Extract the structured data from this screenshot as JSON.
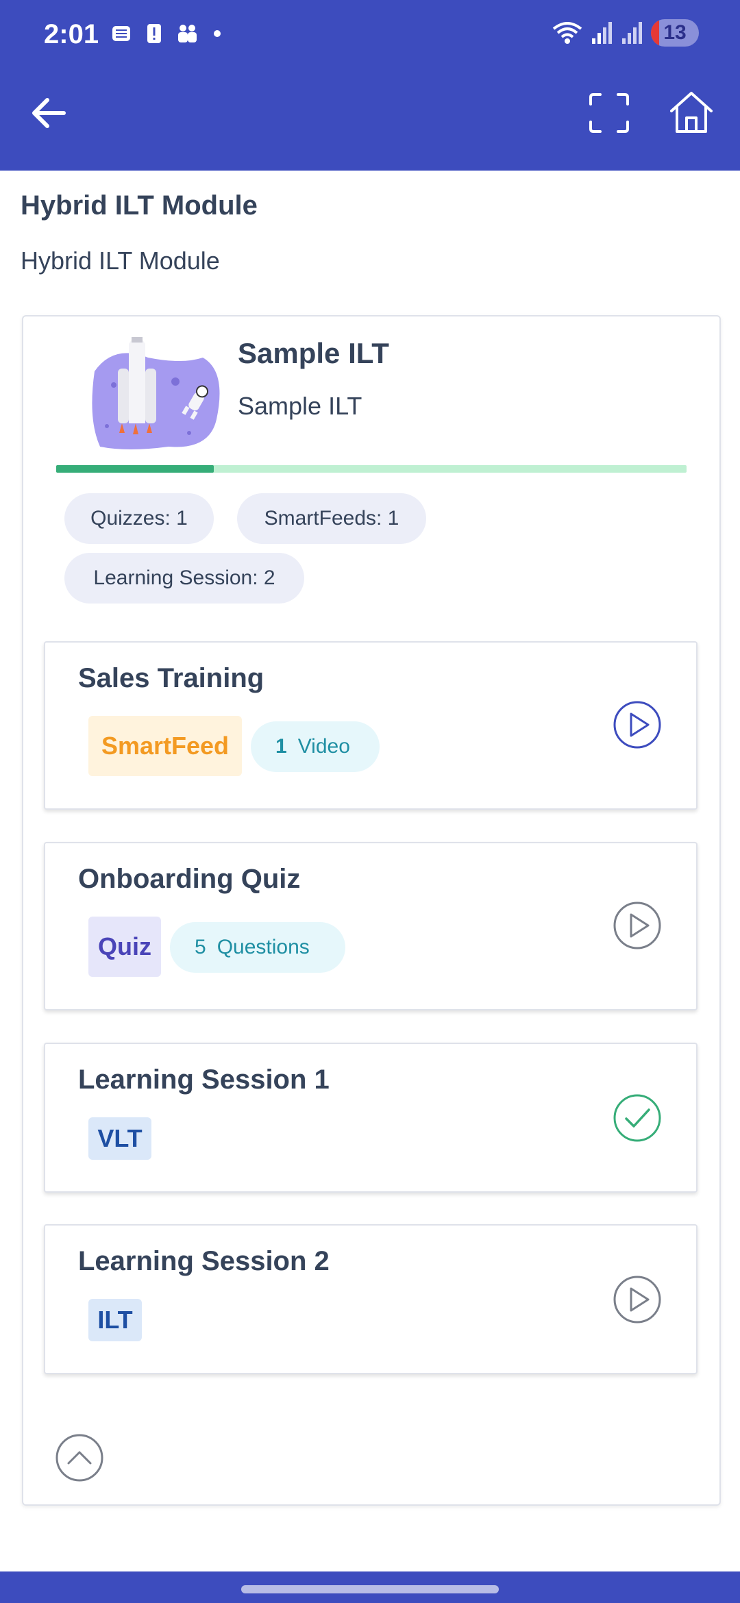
{
  "status_bar": {
    "time": "2:01",
    "battery": "13"
  },
  "page": {
    "title": "Hybrid ILT Module",
    "subtitle": "Hybrid ILT Module"
  },
  "course": {
    "title": "Sample ILT",
    "subtitle": "Sample ILT",
    "progress": 0.25,
    "chips": [
      "Quizzes: 1",
      "SmartFeeds: 1",
      "Learning Session: 2"
    ]
  },
  "items": [
    {
      "title": "Sales Training",
      "badge": "SmartFeed",
      "count": "1",
      "count_label": "Video",
      "status": "play"
    },
    {
      "title": "Onboarding Quiz",
      "badge": "Quiz",
      "count": "5",
      "count_label": "Questions",
      "status": "play"
    },
    {
      "title": "Learning Session 1",
      "badge": "VLT",
      "status": "completed"
    },
    {
      "title": "Learning Session 2",
      "badge": "ILT",
      "status": "play"
    }
  ],
  "colors": {
    "brand": "#3d4cbe",
    "progress_fill": "#36ad78",
    "progress_track": "#bff0d2",
    "completed": "#36ad78",
    "play_active": "#3d4cbe",
    "play_inactive": "#7a7f8a"
  }
}
